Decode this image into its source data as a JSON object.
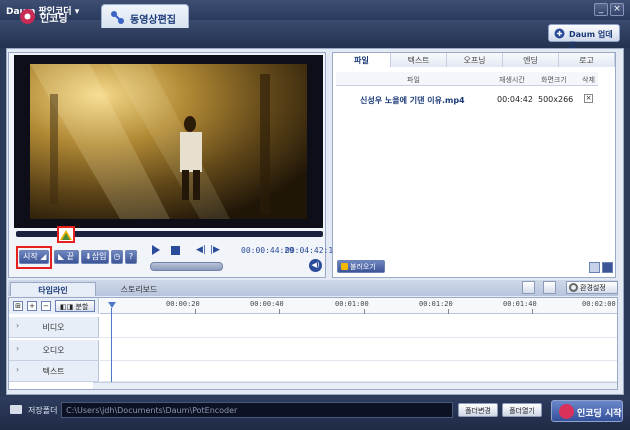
{
  "window": {
    "title": "Daum 팟인코더 ▾",
    "minimize": "_",
    "close": "×"
  },
  "top_tabs": {
    "encoding": "인코딩",
    "edit": "동영상편집"
  },
  "update_button": "Daum 업데드",
  "player": {
    "buttons": {
      "start": "시작",
      "end": "끝",
      "insert": "삽입",
      "help": "?"
    },
    "current_time": "00:00:44:29",
    "total_time": "00:04:42:12"
  },
  "right_panel": {
    "tabs": [
      "파일",
      "텍스트",
      "오프닝",
      "엔딩",
      "로고"
    ],
    "headers": {
      "file": "파일",
      "duration": "재생시간",
      "size": "화면크기",
      "delete": "삭제"
    },
    "file": {
      "name": "신성우 노을에 기댄 이유.mp4",
      "duration": "00:04:42",
      "resolution": "500x266"
    },
    "open_button": "불러오기"
  },
  "timeline": {
    "tabs": {
      "timeline": "타임라인",
      "storyboard": "스토리보드"
    },
    "settings": "환경설정",
    "split_button": "분할",
    "ticks": [
      "00:00:20",
      "00:00:40",
      "00:01:00",
      "00:01:20",
      "00:01:40",
      "00:02:00"
    ],
    "tracks": [
      "비디오",
      "오디오",
      "텍스트"
    ]
  },
  "bottom": {
    "folder_label": "저장폴더",
    "path": "C:\\Users\\jdh\\Documents\\Daum\\PotEncoder",
    "change_folder": "폴더변경",
    "open_folder": "폴더열기",
    "start_encoding": "인코딩 시작"
  },
  "colors": {
    "accent": "#2b4c9a",
    "highlight_box": "#e61f1f"
  }
}
